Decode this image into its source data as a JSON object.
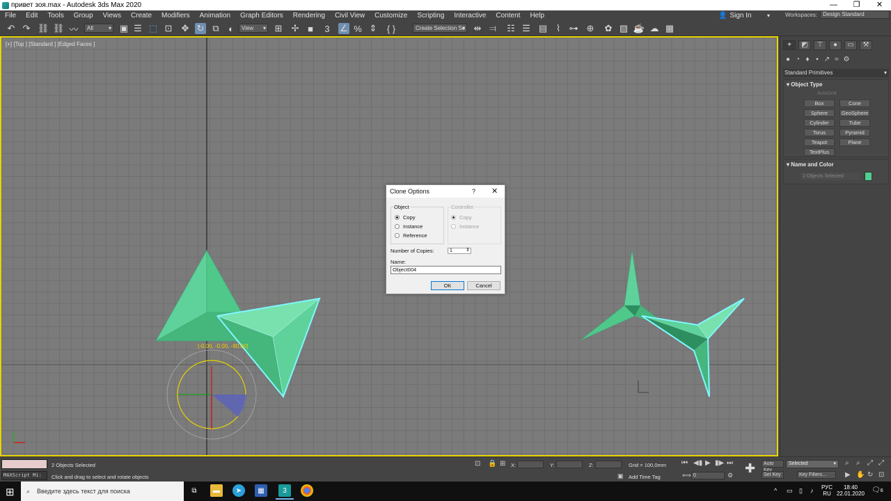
{
  "window": {
    "title": "привет зоя.max - Autodesk 3ds Max 2020",
    "min_icon": "minimize-icon",
    "max_icon": "restore-icon",
    "close_icon": "close-icon"
  },
  "menu": {
    "items": [
      "File",
      "Edit",
      "Tools",
      "Group",
      "Views",
      "Create",
      "Modifiers",
      "Animation",
      "Graph Editors",
      "Rendering",
      "Civil View",
      "Customize",
      "Scripting",
      "Interactive",
      "Content",
      "Help"
    ],
    "sign_in": "Sign In",
    "workspaces_label": "Workspaces:",
    "workspace_value": "Design Standard"
  },
  "toolbar": {
    "filter_value": "All",
    "ref_coord_value": "View",
    "selection_set_value": "Create Selection Se"
  },
  "viewport": {
    "label": "[+] [Top ] [Standard ] [Edged Faces ]",
    "transform_readout": "[-0,00, -0,00, -90,00]",
    "border_color": "#e8d400",
    "mesh_color": "#4fc88a",
    "selection_outline_color": "#7ff7ff"
  },
  "command_panel": {
    "category_dropdown": "Standard Primitives",
    "object_type": {
      "title": "Object Type",
      "autogrid": "AutoGrid",
      "buttons": [
        "Box",
        "Cone",
        "Sphere",
        "GeoSphere",
        "Cylinder",
        "Tube",
        "Torus",
        "Pyramid",
        "Teapot",
        "Plane",
        "TextPlus"
      ]
    },
    "name_and_color": {
      "title": "Name and Color",
      "name_value": "2 Objects Selected",
      "swatch_color": "#4fd08e"
    }
  },
  "dialog": {
    "title": "Clone Options",
    "help": "?",
    "object_group": {
      "label": "Object",
      "options": [
        "Copy",
        "Instance",
        "Reference"
      ],
      "selected": "Copy"
    },
    "controller_group": {
      "label": "Controller",
      "options": [
        "Copy",
        "Instance"
      ],
      "selected": "Copy"
    },
    "copies_label": "Number of Copies:",
    "copies_value": "1",
    "name_label": "Name:",
    "name_value": "Object004",
    "ok": "OK",
    "cancel": "Cancel"
  },
  "status": {
    "maxscript": "MAXScript Mi:",
    "selection_info": "2 Objects Selected",
    "prompt": "Click and drag to select and rotate objects",
    "x_label": "X:",
    "y_label": "Y:",
    "z_label": "Z:",
    "grid": "Grid = 100,0mm",
    "add_time_tag": "Add Time Tag",
    "frame_value": "0",
    "auto_key": "Auto Key",
    "set_key": "Set Key",
    "selected": "Selected",
    "key_filters": "Key Filters..."
  },
  "taskbar": {
    "search_placeholder": "Введите здесь текст для поиска",
    "lang_top": "РУС",
    "lang_bottom": "RU",
    "time": "18:40",
    "date": "22.01.2020",
    "notifications": "6"
  }
}
